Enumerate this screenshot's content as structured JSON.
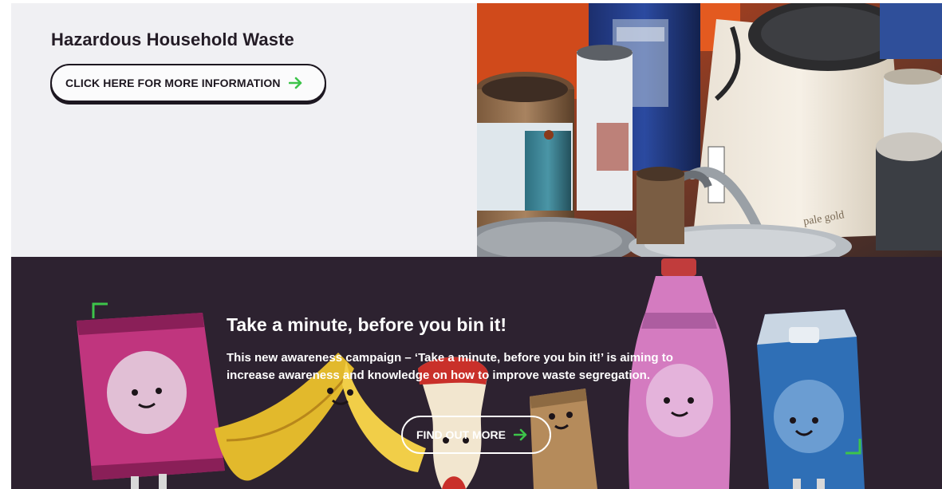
{
  "hazard": {
    "title": "Hazardous Household Waste",
    "button_label": "CLICK HERE FOR MORE INFORMATION",
    "button_icon": "arrow-right-icon",
    "image_alt_subject": "paint-cans"
  },
  "campaign": {
    "title": "Take a minute, before you bin it!",
    "body": "This new awareness campaign –  ‘Take a minute, before you bin it!’  is aiming to increase awareness and knowledge on how to improve waste segregation.",
    "button_label": "FIND OUT MORE",
    "button_icon": "arrow-right-icon"
  },
  "colors": {
    "accent_green": "#3dc44a",
    "panel_light": "#f0f0f3",
    "panel_dark": "#2d2230",
    "text_dark": "#241c26"
  }
}
